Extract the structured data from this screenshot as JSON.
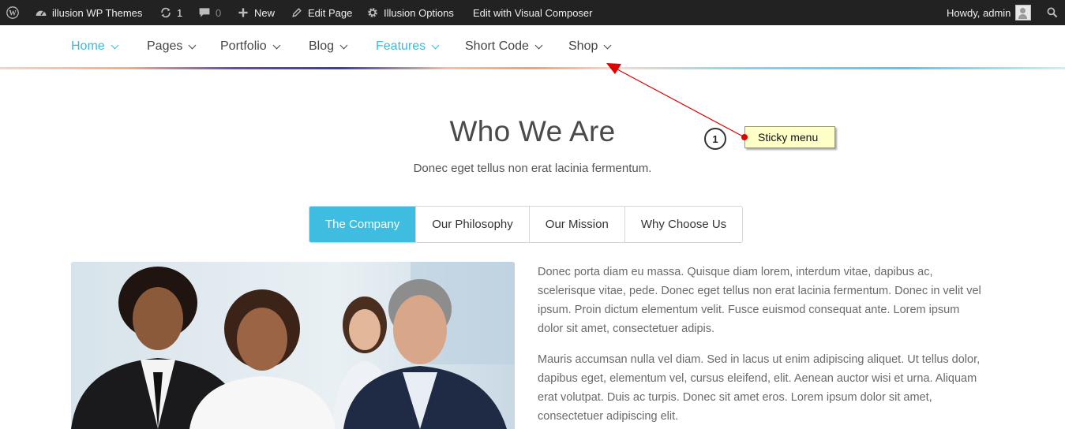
{
  "adminbar": {
    "wp_logo_icon": "wordpress-icon",
    "site_name": "illusion WP Themes",
    "updates_count": "1",
    "comments_count": "0",
    "new_label": "New",
    "edit_page_label": "Edit Page",
    "theme_options_label": "Illusion Options",
    "visual_composer_label": "Edit with Visual Composer",
    "howdy_label": "Howdy, admin"
  },
  "nav": {
    "items": [
      {
        "label": "Home",
        "active": true
      },
      {
        "label": "Pages",
        "active": false
      },
      {
        "label": "Portfolio",
        "active": false
      },
      {
        "label": "Blog",
        "active": false
      },
      {
        "label": "Features",
        "active": true
      },
      {
        "label": "Short Code",
        "active": false
      },
      {
        "label": "Shop",
        "active": false
      }
    ]
  },
  "section": {
    "title": "Who We Are",
    "subtitle": "Donec eget tellus non erat lacinia fermentum."
  },
  "tabs": [
    {
      "label": "The Company",
      "active": true
    },
    {
      "label": "Our Philosophy",
      "active": false
    },
    {
      "label": "Our Mission",
      "active": false
    },
    {
      "label": "Why Choose Us",
      "active": false
    }
  ],
  "content": {
    "paragraph_1": "Donec porta diam eu massa. Quisque diam lorem, interdum vitae, dapibus ac, scelerisque vitae, pede. Donec eget tellus non erat lacinia fermentum. Donec in velit vel ipsum. Proin dictum elementum velit. Fusce euismod consequat ante. Lorem ipsum dolor sit amet, consectetuer adipis.",
    "paragraph_2": "Mauris accumsan nulla vel diam. Sed in lacus ut enim adipiscing aliquet. Ut tellus dolor, dapibus eget, elementum vel, cursus eleifend, elit. Aenean auctor wisi et urna. Aliquam erat volutpat. Duis ac turpis. Donec sit amet eros. Lorem ipsum dolor sit amet, consectetuer adipiscing elit."
  },
  "annotation": {
    "number": "1",
    "label": "Sticky menu"
  },
  "colors": {
    "accent": "#3fbde0",
    "adminbar_bg": "#222222",
    "callout_bg": "#ffffc8",
    "arrow": "#e00000"
  }
}
